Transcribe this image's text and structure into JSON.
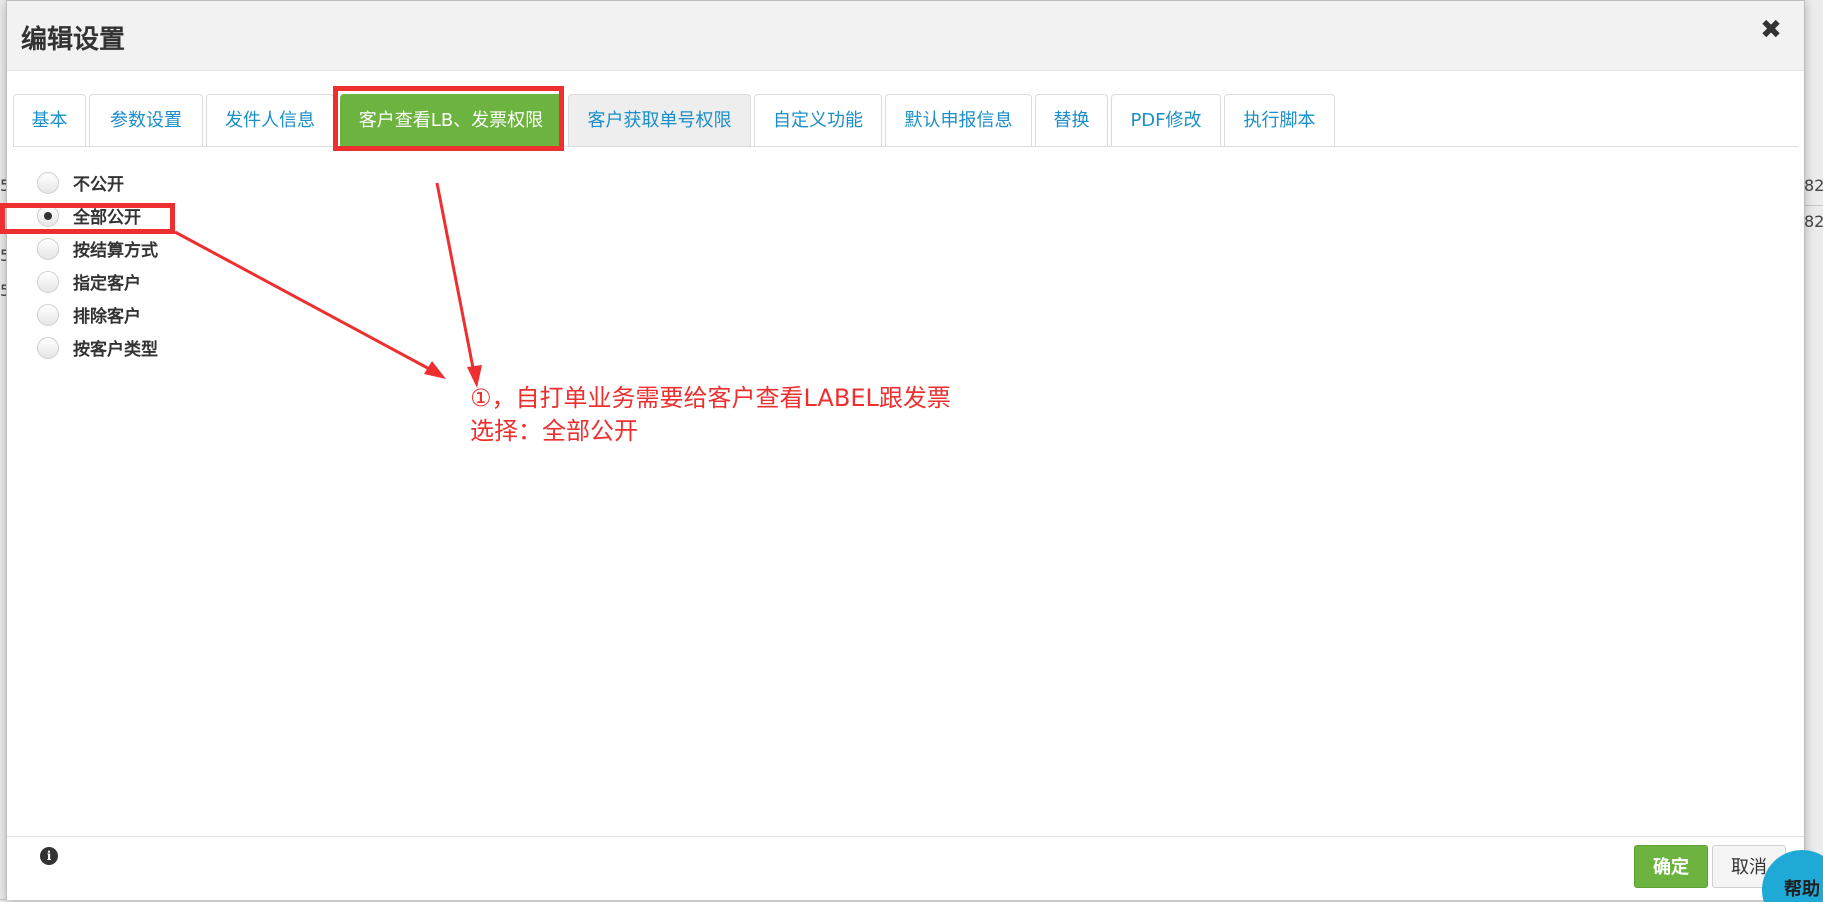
{
  "dialog": {
    "title": "编辑设置",
    "close_icon": "close-icon"
  },
  "tabs": [
    {
      "label": "基本",
      "active": false
    },
    {
      "label": "参数设置",
      "active": false
    },
    {
      "label": "发件人信息",
      "active": false
    },
    {
      "label": "客户查看LB、发票权限",
      "active": true
    },
    {
      "label": "客户获取单号权限",
      "active": false
    },
    {
      "label": "自定义功能",
      "active": false
    },
    {
      "label": "默认申报信息",
      "active": false
    },
    {
      "label": "替换",
      "active": false
    },
    {
      "label": "PDF修改",
      "active": false
    },
    {
      "label": "执行脚本",
      "active": false
    }
  ],
  "options": [
    {
      "label": "不公开",
      "checked": false
    },
    {
      "label": "全部公开",
      "checked": true
    },
    {
      "label": "按结算方式",
      "checked": false
    },
    {
      "label": "指定客户",
      "checked": false
    },
    {
      "label": "排除客户",
      "checked": false
    },
    {
      "label": "按客户类型",
      "checked": false
    }
  ],
  "annotation": {
    "line1": "①，自打单业务需要给客户查看LABEL跟发票",
    "line2": "选择：全部公开",
    "color": "#ee2f2f"
  },
  "footer": {
    "info_icon": "info-icon",
    "confirm_label": "确定",
    "cancel_label": "取消"
  },
  "help": {
    "label": "帮助"
  },
  "background": {
    "frag1": "5",
    "frag2": "5",
    "frag3": "5",
    "frag4": "82",
    "frag5": "82"
  },
  "colors": {
    "accent": "#6db33f",
    "link": "#1a8fc9",
    "annotation": "#ee2f2f",
    "help": "#1fa9d6"
  }
}
